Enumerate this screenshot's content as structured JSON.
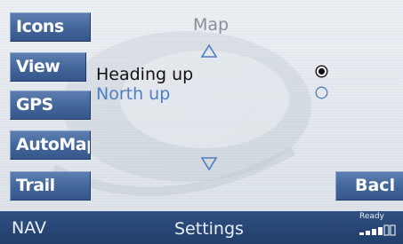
{
  "side_menu": {
    "icons_label": "Icons",
    "view_label": "View",
    "gps_label": "GPS",
    "automap_label": "AutoMap",
    "trail_label": "Trail"
  },
  "panel": {
    "title": "Map",
    "options": [
      {
        "label": "Heading up",
        "selected": true
      },
      {
        "label": "North up",
        "selected": false
      }
    ]
  },
  "back_label": "Bacl",
  "status_bar": {
    "mode": "NAV",
    "context": "Settings",
    "status": "Ready"
  },
  "colors": {
    "button_blue": "#42659a",
    "status_bar": "#223f6c",
    "highlight_text": "#4f7ec4"
  }
}
